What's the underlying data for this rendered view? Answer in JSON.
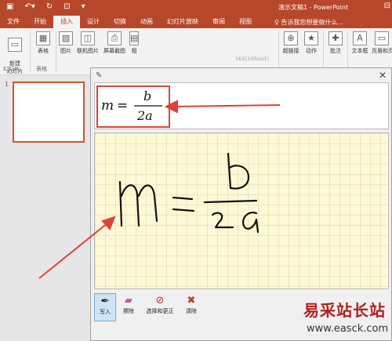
{
  "titlebar": {
    "title": "演示文稿1 - PowerPoint"
  },
  "tabs": [
    "文件",
    "开始",
    "插入",
    "设计",
    "切换",
    "动画",
    "幻灯片放映",
    "审阅",
    "视图"
  ],
  "tellme": "告诉我您想要做什么...",
  "ribbon": {
    "new_slide": "新建\n幻灯片",
    "group_slides": "幻灯片",
    "table": "表格",
    "group_tables": "表格",
    "picture": "图片",
    "online_picture": "联机图片",
    "screenshot": "屏幕截图",
    "album": "相",
    "link": "超链接",
    "action": "动作",
    "comment": "批注",
    "textbox": "文本框",
    "header_footer": "页眉和页",
    "hidden_label": "163C1O5UU1)"
  },
  "slide": {
    "number": "1"
  },
  "math_dialog": {
    "formula": {
      "lhs": "m",
      "eq": "=",
      "num": "b",
      "den": "2a"
    },
    "tools": {
      "write": "写入",
      "erase": "擦除",
      "select_correct": "选择和更正",
      "clear": "清除"
    }
  },
  "watermark": {
    "brand": "易采站长站",
    "url": "www.easck.com"
  }
}
